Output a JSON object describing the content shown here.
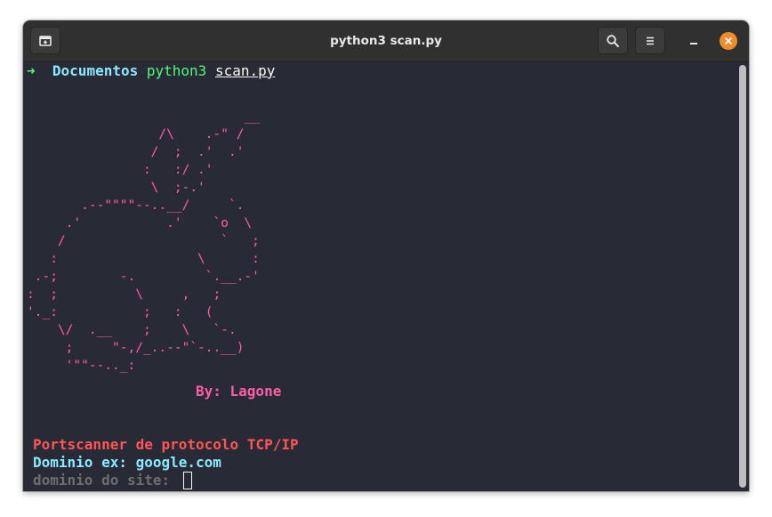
{
  "window": {
    "title": "python3 scan.py",
    "icons": {
      "new_tab": "new-tab-icon",
      "search": "search-icon",
      "menu": "hamburger-menu-icon",
      "minimize": "minimize-icon",
      "close": "close-icon"
    },
    "close_color": "#f28c2b"
  },
  "terminal": {
    "prompt": {
      "arrow": "➜",
      "directory": "Documentos",
      "command": "python3",
      "argument": "scan.py"
    },
    "ascii_art": "                            __\n                 /\\    .-\" /\n                /  ;  .'  .'\n               :   :/ .'\n                \\  ;-.'\n       .--\"\"\"\"--..__/     `.\n     .'           .'    `o  \\\n    /                    `   ;\n   :                  \\      :\n .-;        -.         `.__.-'\n:  ;          \\     ,   ;\n'._:           ;   :   (\n    \\/  .__    ;    \\   `-.\n     ;     \"-,/_..--\"`-..__)\n     '\"\"--.._:",
    "byline": "By: Lagone",
    "scanner_title": "Portscanner de protocolo TCP/IP",
    "example_label": "Dominio ex:",
    "example_value": "google.com",
    "input_prompt": "dominio do site:"
  },
  "colors": {
    "background": "#282a36",
    "prompt_green": "#50fa7b",
    "prompt_cyan": "#8be9fd",
    "art_pink": "#ff5ca8",
    "title_red": "#ff5555",
    "muted_gray": "#6e6e6e"
  }
}
